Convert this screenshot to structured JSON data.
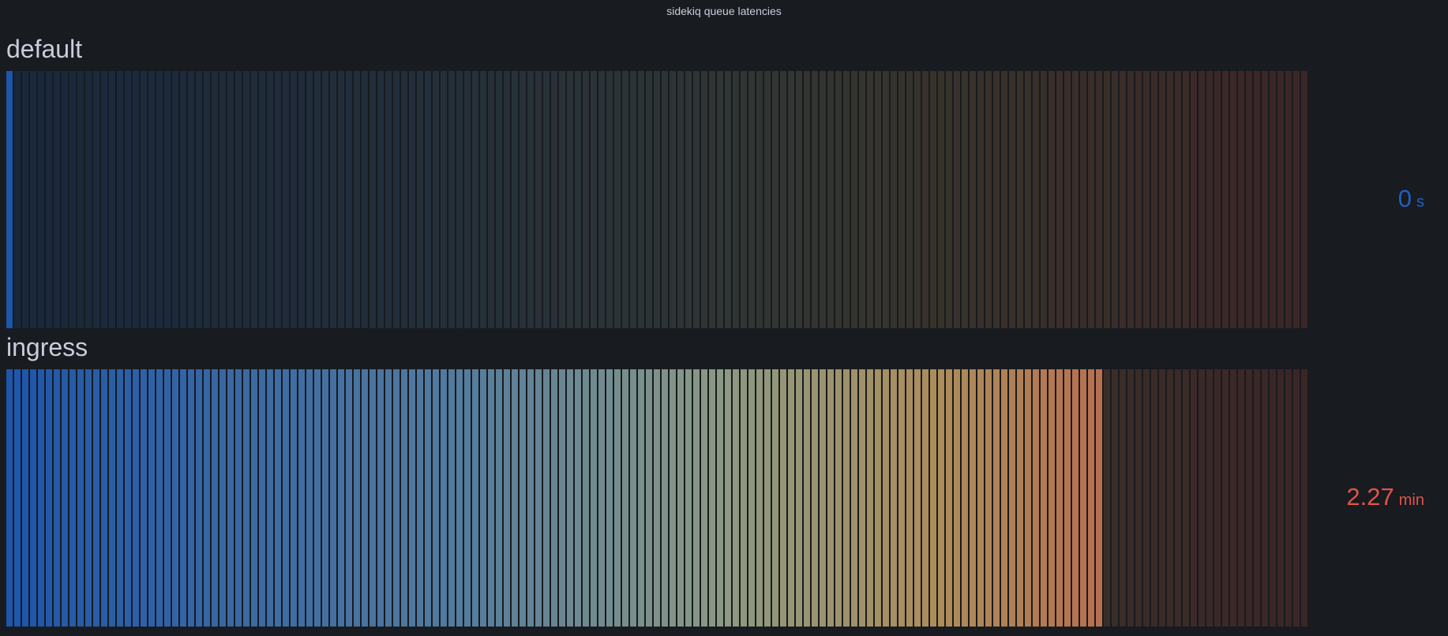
{
  "panel": {
    "title": "sidekiq queue latencies"
  },
  "colors": {
    "background": "#181b1f",
    "text": "#ccccdc",
    "low": "#1f60c4",
    "high": "#e0544a"
  },
  "chart_data": {
    "type": "bar-gauge",
    "orientation": "horizontal",
    "display_mode": "retro-lcd",
    "min_seconds": 0,
    "max_seconds": 162,
    "series": [
      {
        "name": "default",
        "value_seconds": 0,
        "display_value": "0",
        "display_unit": "s",
        "color": "#1f60c4"
      },
      {
        "name": "ingress",
        "value_seconds": 136.2,
        "display_value": "2.27",
        "display_unit": "min",
        "color": "#e0544a"
      }
    ]
  }
}
